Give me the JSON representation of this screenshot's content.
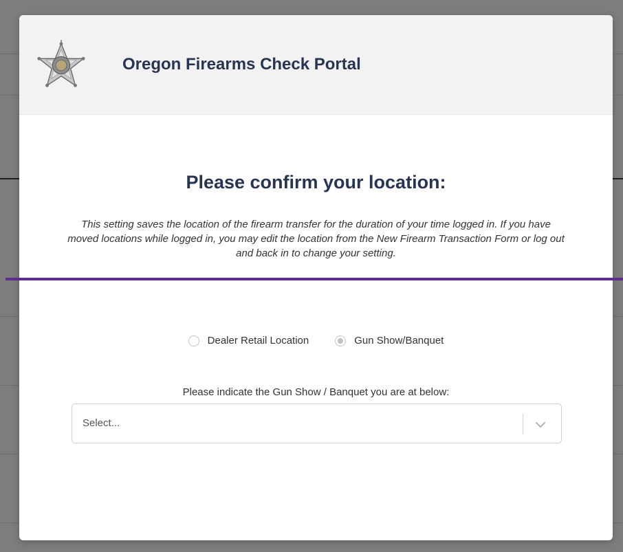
{
  "header": {
    "badge_icon": "sheriff-star-badge-icon",
    "title": "Oregon Firearms Check Portal"
  },
  "location": {
    "heading": "Please confirm your location:",
    "description": "This setting saves the location of the firearm transfer for the duration of your time logged in. If you have moved locations while logged in, you may edit the location from the New Firearm Transaction Form or log out and back in to change your setting.",
    "options": [
      {
        "label": "Dealer Retail Location",
        "selected": false
      },
      {
        "label": "Gun Show/Banquet",
        "selected": true
      }
    ],
    "gun_show_prompt": "Please indicate the Gun Show / Banquet you are at below:",
    "select_placeholder": "Select..."
  },
  "colors": {
    "title": "#283552",
    "accent_bar": "#5b2d8e",
    "header_bg": "#f2f2f2"
  }
}
